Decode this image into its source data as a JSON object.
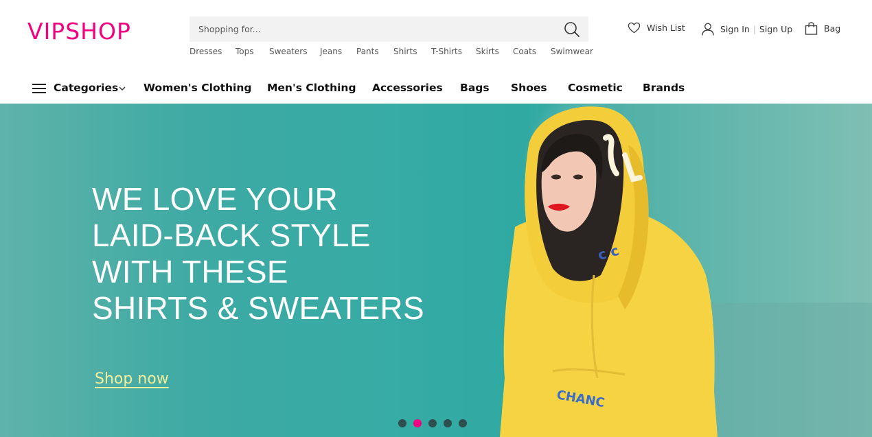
{
  "header": {
    "logo": "VIPSHOP",
    "search": {
      "placeholder": "Shopping for...",
      "value": ""
    },
    "quick_links": [
      "Dresses",
      "Tops",
      "Sweaters",
      "Jeans",
      "Pants",
      "Shirts",
      "T-Shirts",
      "Skirts",
      "Coats",
      "Swimwear"
    ],
    "wish_list": "Wish List",
    "sign_in": "Sign In",
    "separator": "|",
    "sign_up": "Sign Up",
    "bag": "Bag"
  },
  "nav": {
    "categories": "Categories",
    "items": [
      "Women's Clothing",
      "Men's Clothing",
      "Accessories",
      "Bags",
      "Shoes",
      "Cosmetic",
      "Brands"
    ]
  },
  "hero": {
    "headline": [
      "WE LOVE YOUR",
      "LAID-BACK STYLE",
      "WITH THESE",
      "SHIRTS & SWEATERS"
    ],
    "cta": "Shop now",
    "active_slide": 2,
    "slide_count": 5
  },
  "colors": {
    "brand": "#f10180",
    "hero_bg": "#37aba5",
    "cta": "#f2ef9a",
    "sweater": "#f5d343"
  }
}
